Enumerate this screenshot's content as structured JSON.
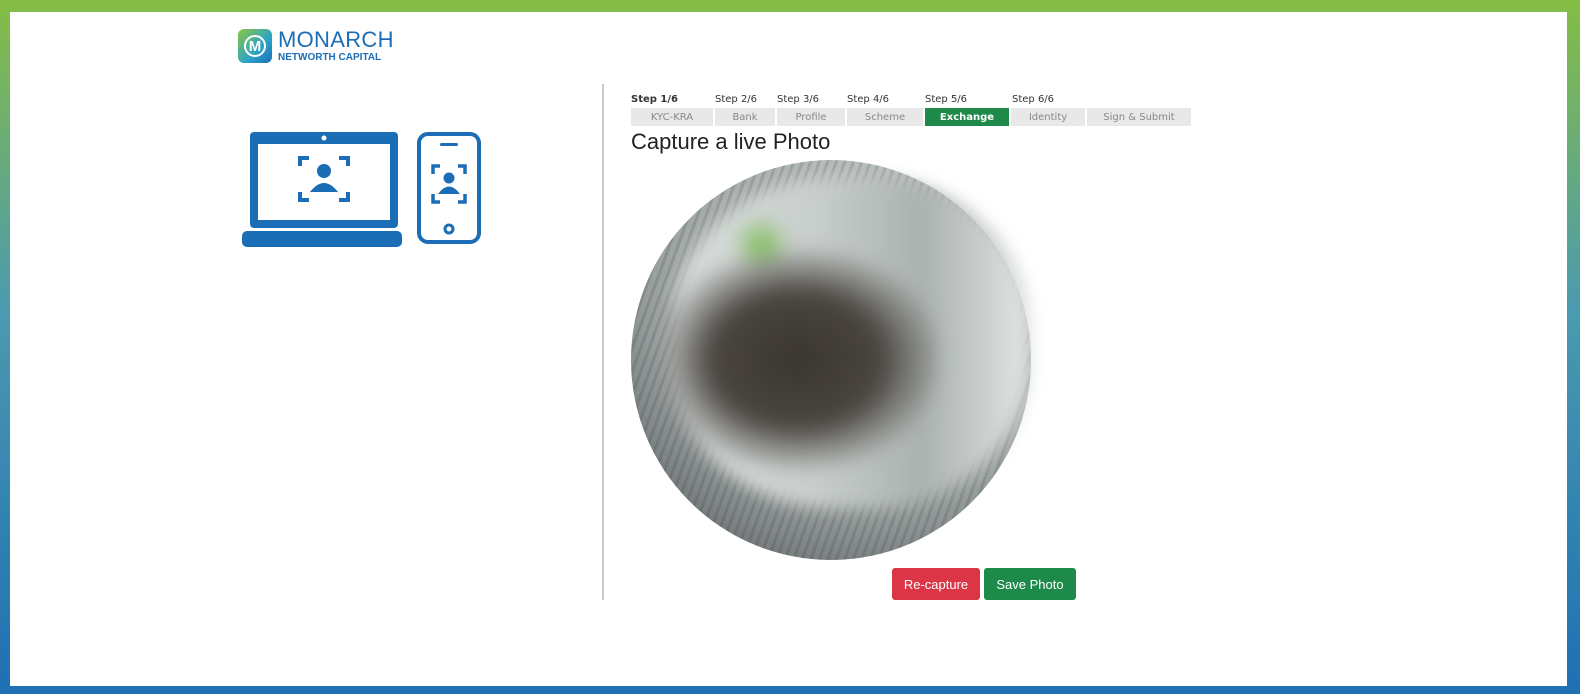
{
  "brand": {
    "name": "MONARCH",
    "subtitle": "NETWORTH CAPITAL",
    "colors": {
      "primary": "#1b6db5",
      "accent": "#8cc63f"
    }
  },
  "illustration": {
    "laptop_icon": "laptop-face-scan-icon",
    "phone_icon": "phone-face-scan-icon",
    "color": "#1b6db5"
  },
  "steps": [
    {
      "step": "Step 1/6",
      "name": "KYC-KRA"
    },
    {
      "step": "Step 2/6",
      "name": "Bank"
    },
    {
      "step": "Step 3/6",
      "name": "Profile"
    },
    {
      "step": "Step 4/6",
      "name": "Scheme"
    },
    {
      "step": "Step 5/6",
      "name": "Exchange"
    },
    {
      "step": "Step 6/6",
      "name": "Identity"
    },
    {
      "step": "",
      "name": "Sign & Submit"
    }
  ],
  "current_step_color": "#1e8a4a",
  "page": {
    "title": "Capture a live Photo"
  },
  "actions": {
    "recapture_label": "Re-capture",
    "save_label": "Save Photo",
    "recapture_color": "#dc3545",
    "save_color": "#1e8a4a"
  }
}
